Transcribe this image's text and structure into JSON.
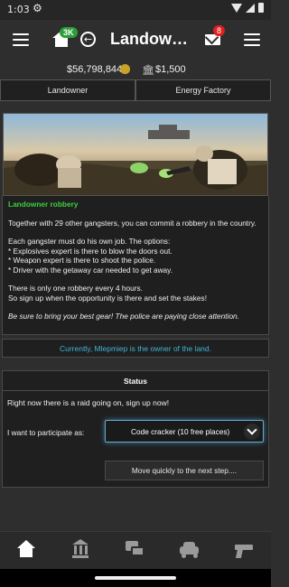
{
  "status_bar": {
    "time": "1:03"
  },
  "header": {
    "title": "Landowne…",
    "home_badge": "3K",
    "mail_badge": "8"
  },
  "money": {
    "cash": "$56,798,844",
    "bank": "$1,500"
  },
  "tabs": [
    {
      "label": "Landowner"
    },
    {
      "label": "Energy Factory"
    }
  ],
  "robbery": {
    "heading": "Landowner robbery",
    "intro": "Together with 29 other gangsters, you can commit a robbery in the country.",
    "options": "Each gangster must do his own job. The options:\n* Explosives expert is there to blow the doors out.\n* Weapon expert is there to shoot the police.\n* Driver with the getaway car needed to get away.",
    "schedule": "There is only one robbery every 4 hours.\nSo sign up when the opportunity is there and set the stakes!",
    "note": "Be sure to bring your best gear! The police are paying close attention."
  },
  "owner_text": "Currently, Mlepmiep is the owner of the land.",
  "status": {
    "heading": "Status",
    "raid_text": "Right now there is a raid going on, sign up now!",
    "participate_label": "I want to participate as:",
    "selected_role": "Code cracker (10 free places)",
    "next_button": "Move quickly to the next step...."
  },
  "icons": {
    "nav": [
      "home-icon",
      "bank-icon",
      "chat-icon",
      "car-icon",
      "gun-icon"
    ]
  },
  "colors": {
    "accent_green": "#3ccf3c",
    "accent_blue": "#3fb6d8",
    "badge_red": "#e02020",
    "badge_green": "#2e9e3a"
  }
}
